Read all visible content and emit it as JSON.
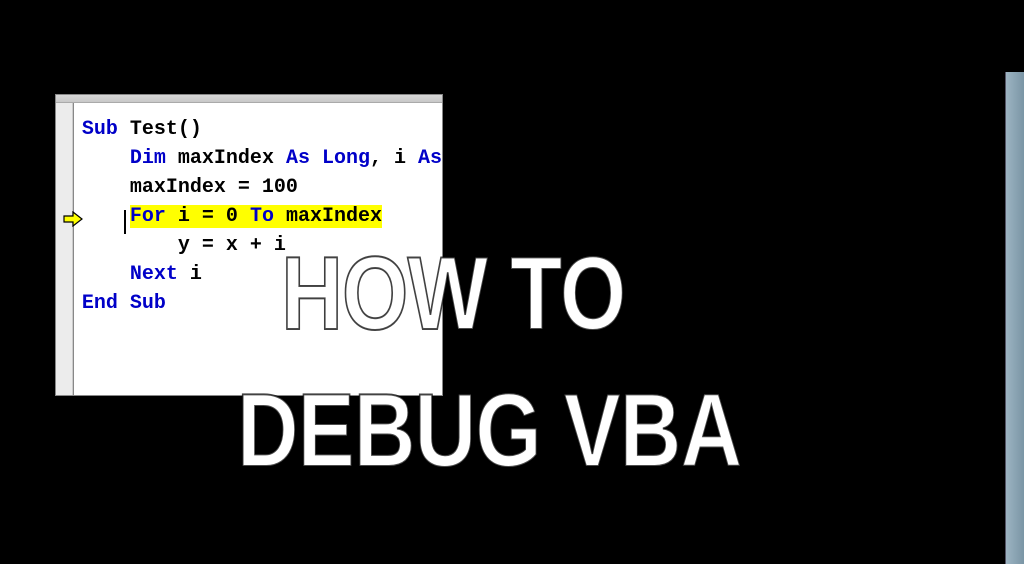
{
  "code": {
    "line1_kw": "Sub",
    "line1_rest": " Test()",
    "line2_kw1": "Dim",
    "line2_mid": " maxIndex ",
    "line2_kw2": "As Long",
    "line2_mid2": ", i ",
    "line2_kw3": "As",
    "line3": "maxIndex = 100",
    "line4_kw": "For",
    "line4_mid": " i = 0 ",
    "line4_kw2": "To",
    "line4_rest": " maxIndex",
    "line5": "y = x + i",
    "line6_kw": "Next",
    "line6_rest": " i",
    "line7": "End Sub"
  },
  "overlay": {
    "line1": "HOW TO",
    "line2": "DEBUG VBA"
  },
  "colors": {
    "highlight": "#ffff00",
    "keyword": "#0000C8",
    "background": "#000000"
  }
}
